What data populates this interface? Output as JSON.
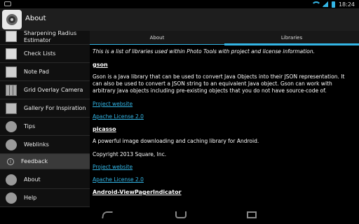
{
  "status_bar": {
    "time": "18:24"
  },
  "action_bar": {
    "title": "About"
  },
  "sidebar": {
    "items": [
      {
        "label": "Sharpening Radius Estimator",
        "icon": "sharpen-icon"
      },
      {
        "label": "Check Lists",
        "icon": "checklist-icon"
      },
      {
        "label": "Note Pad",
        "icon": "notepad-icon"
      },
      {
        "label": "Grid Overlay Camera",
        "icon": "grid-icon"
      },
      {
        "label": "Gallery For Inspiration",
        "icon": "gallery-icon"
      },
      {
        "label": "Tips",
        "icon": "speech-bubble-icon"
      },
      {
        "label": "Weblinks",
        "icon": "speech-bubble-icon"
      },
      {
        "label": "Feedback",
        "icon": "info-icon"
      },
      {
        "label": "About",
        "icon": "speech-bubble-icon"
      },
      {
        "label": "Help",
        "icon": "speech-bubble-icon"
      }
    ]
  },
  "tabs": [
    {
      "label": "About"
    },
    {
      "label": "Libraries"
    }
  ],
  "content": {
    "intro": "This is a list of libraries used within Photo Tools with project and license information.",
    "libraries": [
      {
        "name": "gson",
        "description": "Gson is a Java library that can be used to convert Java Objects into their JSON representation. It can also be used to convert a JSON string to an equivalent Java object. Gson can work with arbitrary Java objects including pre-existing objects that you do not have source-code of.",
        "project_link": "Project website",
        "license_link": "Apache License 2.0"
      },
      {
        "name": "picasso",
        "description": "A powerful image downloading and caching library for Android.",
        "copyright": "Copyright 2013 Square, Inc.",
        "project_link": "Project website",
        "license_link": "Apache License 2.0"
      },
      {
        "name": "Android-ViewPagerIndicator"
      }
    ]
  },
  "colors": {
    "accent": "#33b5e5",
    "selected_item": "#3a3a3a"
  }
}
